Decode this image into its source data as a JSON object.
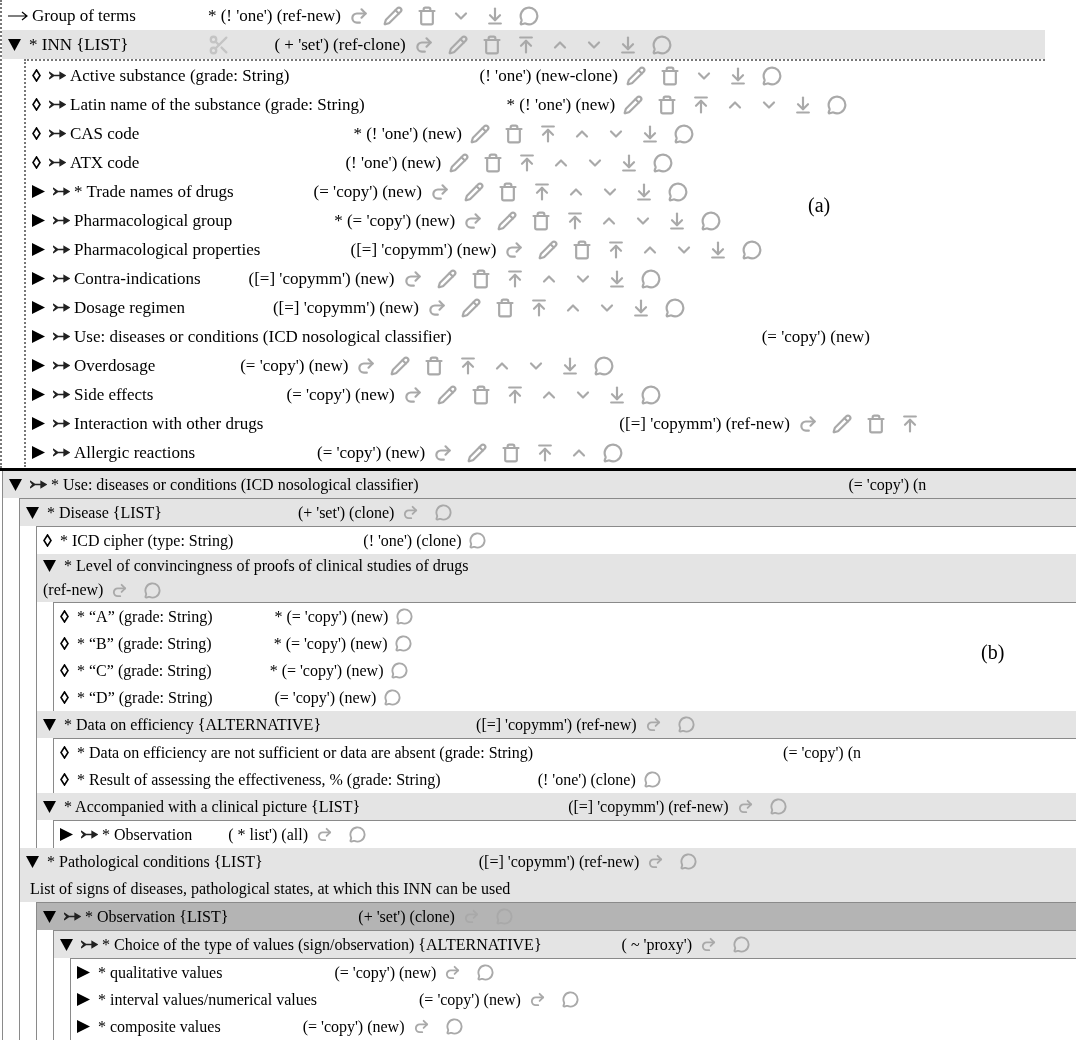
{
  "panel_a": {
    "figure_label": "(a)",
    "rows": [
      {
        "kind": "reference",
        "label": "Group of terms",
        "annotation": "* (! 'one') (ref-new)",
        "link": false,
        "selected": false,
        "actions": [
          {
            "kind": "clone"
          },
          {
            "kind": "edit"
          },
          {
            "kind": "delete"
          },
          {
            "kind": "down"
          },
          {
            "kind": "bottom"
          },
          {
            "kind": "info"
          }
        ]
      },
      {
        "kind": "branch",
        "expanded": true,
        "label": "* INN {LIST}",
        "cut": true,
        "annotation": "( + 'set') (ref-clone)",
        "link": false,
        "selected": false,
        "actions": [
          {
            "kind": "clone"
          },
          {
            "kind": "edit"
          },
          {
            "kind": "delete"
          },
          {
            "kind": "top"
          },
          {
            "kind": "up"
          },
          {
            "kind": "down"
          },
          {
            "kind": "bottom"
          },
          {
            "kind": "info"
          }
        ],
        "children": [
          {
            "kind": "leaf",
            "label": "Active substance (grade: String)",
            "annotation": "(! 'one') (new-clone)",
            "link": true,
            "selected": false,
            "actions": [
              {
                "kind": "edit"
              },
              {
                "kind": "delete"
              },
              {
                "kind": "down"
              },
              {
                "kind": "bottom"
              },
              {
                "kind": "info"
              }
            ]
          },
          {
            "kind": "leaf",
            "label": "Latin name of the substance (grade: String)",
            "annotation": "* (! 'one') (new)",
            "link": true,
            "selected": false,
            "actions": [
              {
                "kind": "edit"
              },
              {
                "kind": "delete"
              },
              {
                "kind": "top"
              },
              {
                "kind": "up"
              },
              {
                "kind": "down"
              },
              {
                "kind": "bottom"
              },
              {
                "kind": "info"
              }
            ]
          },
          {
            "kind": "leaf",
            "label": "CAS code",
            "annotation": "* (! 'one') (new)",
            "link": true,
            "selected": false,
            "actions": [
              {
                "kind": "edit"
              },
              {
                "kind": "delete"
              },
              {
                "kind": "top"
              },
              {
                "kind": "up"
              },
              {
                "kind": "down"
              },
              {
                "kind": "bottom"
              },
              {
                "kind": "info"
              }
            ]
          },
          {
            "kind": "leaf",
            "label": "ATX code",
            "annotation": "(! 'one') (new)",
            "link": true,
            "selected": false,
            "actions": [
              {
                "kind": "edit"
              },
              {
                "kind": "delete"
              },
              {
                "kind": "top"
              },
              {
                "kind": "up"
              },
              {
                "kind": "down"
              },
              {
                "kind": "bottom"
              },
              {
                "kind": "info"
              }
            ]
          },
          {
            "kind": "branch",
            "expanded": false,
            "label": "* Trade names of drugs",
            "annotation": "(= 'copy') (new)",
            "link": true,
            "selected": false,
            "actions": [
              {
                "kind": "clone"
              },
              {
                "kind": "edit"
              },
              {
                "kind": "delete"
              },
              {
                "kind": "top"
              },
              {
                "kind": "up"
              },
              {
                "kind": "down"
              },
              {
                "kind": "bottom"
              },
              {
                "kind": "info"
              }
            ]
          },
          {
            "kind": "branch",
            "expanded": false,
            "label": "Pharmacological group",
            "annotation": "* (= 'copy') (new)",
            "link": true,
            "selected": false,
            "actions": [
              {
                "kind": "clone"
              },
              {
                "kind": "edit"
              },
              {
                "kind": "delete"
              },
              {
                "kind": "top"
              },
              {
                "kind": "up"
              },
              {
                "kind": "down"
              },
              {
                "kind": "bottom"
              },
              {
                "kind": "info"
              }
            ]
          },
          {
            "kind": "branch",
            "expanded": false,
            "label": "Pharmacological properties",
            "annotation": "([=] 'copymm') (new)",
            "link": true,
            "selected": false,
            "actions": [
              {
                "kind": "clone"
              },
              {
                "kind": "edit"
              },
              {
                "kind": "delete"
              },
              {
                "kind": "top"
              },
              {
                "kind": "up"
              },
              {
                "kind": "down"
              },
              {
                "kind": "bottom"
              },
              {
                "kind": "info"
              }
            ]
          },
          {
            "kind": "branch",
            "expanded": false,
            "label": "Contra-indications",
            "annotation": "([=] 'copymm') (new)",
            "link": true,
            "selected": false,
            "actions": [
              {
                "kind": "clone"
              },
              {
                "kind": "edit"
              },
              {
                "kind": "delete"
              },
              {
                "kind": "top"
              },
              {
                "kind": "up"
              },
              {
                "kind": "down"
              },
              {
                "kind": "bottom"
              },
              {
                "kind": "info"
              }
            ]
          },
          {
            "kind": "branch",
            "expanded": false,
            "label": "Dosage regimen",
            "annotation": "([=] 'copymm') (new)",
            "link": true,
            "selected": false,
            "actions": [
              {
                "kind": "clone"
              },
              {
                "kind": "edit"
              },
              {
                "kind": "delete"
              },
              {
                "kind": "top"
              },
              {
                "kind": "up"
              },
              {
                "kind": "down"
              },
              {
                "kind": "bottom"
              },
              {
                "kind": "info"
              }
            ]
          },
          {
            "kind": "branch",
            "expanded": false,
            "label": "Use: diseases or conditions (ICD nosological classifier)",
            "annotation": "(= 'copy') (new)",
            "link": true,
            "selected": false
          },
          {
            "kind": "branch",
            "expanded": false,
            "label": "Overdosage",
            "annotation": "(= 'copy') (new)",
            "link": true,
            "selected": false,
            "actions": [
              {
                "kind": "clone"
              },
              {
                "kind": "edit"
              },
              {
                "kind": "delete"
              },
              {
                "kind": "top"
              },
              {
                "kind": "up"
              },
              {
                "kind": "down"
              },
              {
                "kind": "bottom"
              },
              {
                "kind": "info"
              }
            ]
          },
          {
            "kind": "branch",
            "expanded": false,
            "label": "Side effects",
            "annotation": "(= 'copy') (new)",
            "link": true,
            "selected": false,
            "actions": [
              {
                "kind": "clone"
              },
              {
                "kind": "edit"
              },
              {
                "kind": "delete"
              },
              {
                "kind": "top"
              },
              {
                "kind": "up"
              },
              {
                "kind": "down"
              },
              {
                "kind": "bottom"
              },
              {
                "kind": "info"
              }
            ]
          },
          {
            "kind": "branch",
            "expanded": false,
            "label": "Interaction with other drugs",
            "annotation": "([=] 'copymm') (ref-new)",
            "link": true,
            "selected": false,
            "actions": [
              {
                "kind": "clone"
              },
              {
                "kind": "edit"
              },
              {
                "kind": "delete"
              },
              {
                "kind": "top"
              }
            ]
          },
          {
            "kind": "branch",
            "expanded": false,
            "label": "Allergic reactions",
            "annotation": "(= 'copy') (new)",
            "link": true,
            "selected": false,
            "actions": [
              {
                "kind": "clone"
              },
              {
                "kind": "edit"
              },
              {
                "kind": "delete"
              },
              {
                "kind": "top"
              },
              {
                "kind": "up"
              },
              {
                "kind": "info"
              }
            ]
          }
        ]
      }
    ]
  },
  "panel_b": {
    "figure_label": "(b)",
    "rows": [
      {
        "kind": "branch",
        "expanded": true,
        "label": "* Use: diseases or conditions (ICD nosological classifier)",
        "annotation": "(= 'copy') (n",
        "link": true,
        "selected": false,
        "children": [
          {
            "kind": "branch",
            "expanded": true,
            "label": "* Disease {LIST}",
            "annotation": "(+ 'set') (clone)",
            "link": false,
            "selected": false,
            "actions": [
              {
                "kind": "clone"
              },
              {
                "kind": "info"
              }
            ],
            "children": [
              {
                "kind": "leaf",
                "label": "* ICD cipher (type: String)",
                "annotation": "(! 'one') (clone)",
                "link": false,
                "selected": false,
                "actions": [
                  {
                    "kind": "info"
                  }
                ]
              },
              {
                "kind": "branch",
                "expanded": true,
                "label": "* Level of convincingness of proofs of clinical studies of drugs",
                "annotation": "(ref-new)",
                "link": false,
                "selected": false,
                "actions": [
                  {
                    "kind": "clone"
                  },
                  {
                    "kind": "info"
                  }
                ],
                "children": [
                  {
                    "kind": "leaf",
                    "label": "* “A” (grade: String)",
                    "annotation": "* (= 'copy') (new)",
                    "link": false,
                    "selected": false,
                    "actions": [
                      {
                        "kind": "info"
                      }
                    ]
                  },
                  {
                    "kind": "leaf",
                    "label": "* “B” (grade: String)",
                    "annotation": "* (= 'copy') (new)",
                    "link": false,
                    "selected": false,
                    "actions": [
                      {
                        "kind": "info"
                      }
                    ]
                  },
                  {
                    "kind": "leaf",
                    "label": "* “C” (grade: String)",
                    "annotation": "* (= 'copy') (new)",
                    "link": false,
                    "selected": false,
                    "actions": [
                      {
                        "kind": "info"
                      }
                    ]
                  },
                  {
                    "kind": "leaf",
                    "label": "* “D” (grade: String)",
                    "annotation": "(= 'copy') (new)",
                    "link": false,
                    "selected": false,
                    "actions": [
                      {
                        "kind": "info"
                      }
                    ]
                  }
                ]
              },
              {
                "kind": "branch",
                "expanded": true,
                "label": "* Data on efficiency {ALTERNATIVE}",
                "annotation": "([=] 'copymm') (ref-new)",
                "link": false,
                "selected": false,
                "actions": [
                  {
                    "kind": "clone"
                  },
                  {
                    "kind": "info"
                  }
                ],
                "children": [
                  {
                    "kind": "leaf",
                    "label": "* Data on efficiency are not sufficient or data are absent (grade: String)",
                    "annotation": "(= 'copy') (n",
                    "link": false,
                    "selected": false
                  },
                  {
                    "kind": "leaf",
                    "label": "* Result of assessing the effectiveness, % (grade: String)",
                    "annotation": "(! 'one') (clone)",
                    "link": false,
                    "selected": false,
                    "actions": [
                      {
                        "kind": "info"
                      }
                    ]
                  }
                ]
              },
              {
                "kind": "branch",
                "expanded": true,
                "label": "* Accompanied with a clinical picture {LIST}",
                "annotation": "([=] 'copymm') (ref-new)",
                "link": false,
                "selected": false,
                "actions": [
                  {
                    "kind": "clone"
                  },
                  {
                    "kind": "info"
                  }
                ],
                "children": [
                  {
                    "kind": "branch",
                    "expanded": false,
                    "label": "* Observation",
                    "annotation": "( * list') (all)",
                    "link": true,
                    "selected": false,
                    "actions": [
                      {
                        "kind": "clone"
                      },
                      {
                        "kind": "info"
                      }
                    ]
                  }
                ]
              }
            ]
          },
          {
            "kind": "branch",
            "expanded": true,
            "label": "* Pathological conditions {LIST}",
            "annotation": "([=] 'copymm') (ref-new)",
            "link": false,
            "selected": false,
            "actions": [
              {
                "kind": "clone"
              },
              {
                "kind": "info"
              }
            ],
            "description": "List of signs of diseases, pathological states, at which this INN can be used",
            "children": [
              {
                "kind": "branch",
                "expanded": true,
                "label": "* Observation {LIST}",
                "annotation": "(+ 'set') (clone)",
                "link": true,
                "selected": true,
                "actions": [
                  {
                    "kind": "clone"
                  },
                  {
                    "kind": "info"
                  }
                ],
                "children": [
                  {
                    "kind": "branch",
                    "expanded": true,
                    "label": "* Choice of the type of values (sign/observation) {ALTERNATIVE}",
                    "annotation": "( ~ 'proxy')",
                    "link": true,
                    "selected": false,
                    "actions": [
                      {
                        "kind": "clone"
                      },
                      {
                        "kind": "info"
                      }
                    ],
                    "children": [
                      {
                        "kind": "branch",
                        "expanded": false,
                        "label": "* qualitative values",
                        "annotation": "(= 'copy') (new)",
                        "link": false,
                        "selected": false,
                        "actions": [
                          {
                            "kind": "clone"
                          },
                          {
                            "kind": "info"
                          }
                        ]
                      },
                      {
                        "kind": "branch",
                        "expanded": false,
                        "label": "* interval values/numerical values",
                        "annotation": "(= 'copy') (new)",
                        "link": false,
                        "selected": false,
                        "actions": [
                          {
                            "kind": "clone"
                          },
                          {
                            "kind": "info"
                          }
                        ]
                      },
                      {
                        "kind": "branch",
                        "expanded": false,
                        "label": "* composite values",
                        "annotation": "(= 'copy') (new)",
                        "link": false,
                        "selected": false,
                        "actions": [
                          {
                            "kind": "clone"
                          },
                          {
                            "kind": "info"
                          }
                        ]
                      }
                    ]
                  }
                ]
              }
            ]
          }
        ]
      }
    ]
  }
}
